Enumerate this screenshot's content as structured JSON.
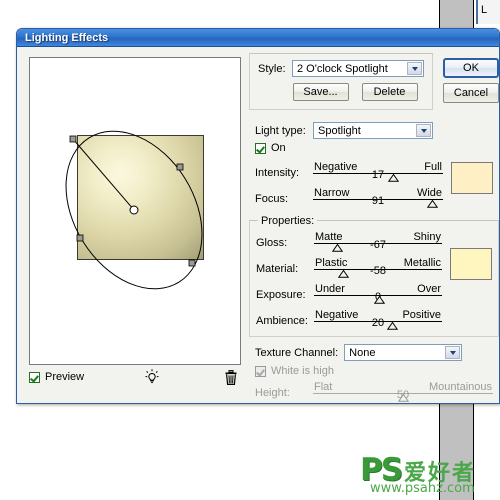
{
  "background": {
    "right_dialog_fragment": "L"
  },
  "watermark": {
    "ps": "PS",
    "chinese": "爱好者",
    "url": "www.psahz.com"
  },
  "dialog": {
    "title": "Lighting Effects",
    "buttons": {
      "ok": "OK",
      "cancel": "Cancel",
      "save": "Save...",
      "delete": "Delete"
    },
    "style": {
      "label": "Style:",
      "value": "2 O'clock Spotlight"
    },
    "light_type": {
      "label": "Light type:",
      "value": "Spotlight"
    },
    "on": {
      "label": "On",
      "checked": true
    },
    "sliders": [
      {
        "name": "intensity",
        "label": "Intensity:",
        "left": "Negative",
        "right": "Full",
        "value": "17",
        "pos": 60
      },
      {
        "name": "focus",
        "label": "Focus:",
        "left": "Narrow",
        "right": "Wide",
        "value": "91",
        "pos": 91
      },
      {
        "name": "gloss",
        "label": "Gloss:",
        "left": "Matte",
        "right": "Shiny",
        "value": "-67",
        "pos": 17
      },
      {
        "name": "material",
        "label": "Material:",
        "left": "Plastic",
        "right": "Metallic",
        "value": "-58",
        "pos": 21
      },
      {
        "name": "exposure",
        "label": "Exposure:",
        "left": "Under",
        "right": "Over",
        "value": "0",
        "pos": 50
      },
      {
        "name": "ambience",
        "label": "Ambience:",
        "left": "Negative",
        "right": "Positive",
        "value": "20",
        "pos": 60
      }
    ],
    "properties_title": "Properties:",
    "texture_channel": {
      "label": "Texture Channel:",
      "value": "None"
    },
    "white_is_high": {
      "label": "White is high",
      "checked": true,
      "disabled": true
    },
    "height_slider": {
      "label": "Height:",
      "left": "Flat",
      "right": "Mountainous",
      "value": "50",
      "pos": 50
    },
    "preview": {
      "label": "Preview",
      "checked": true
    },
    "colors": {
      "light_swatch": "#ffefc4",
      "material_swatch": "#fff6bf",
      "titlebar": "#2f74cf",
      "accent": "#2a5fa5"
    }
  }
}
